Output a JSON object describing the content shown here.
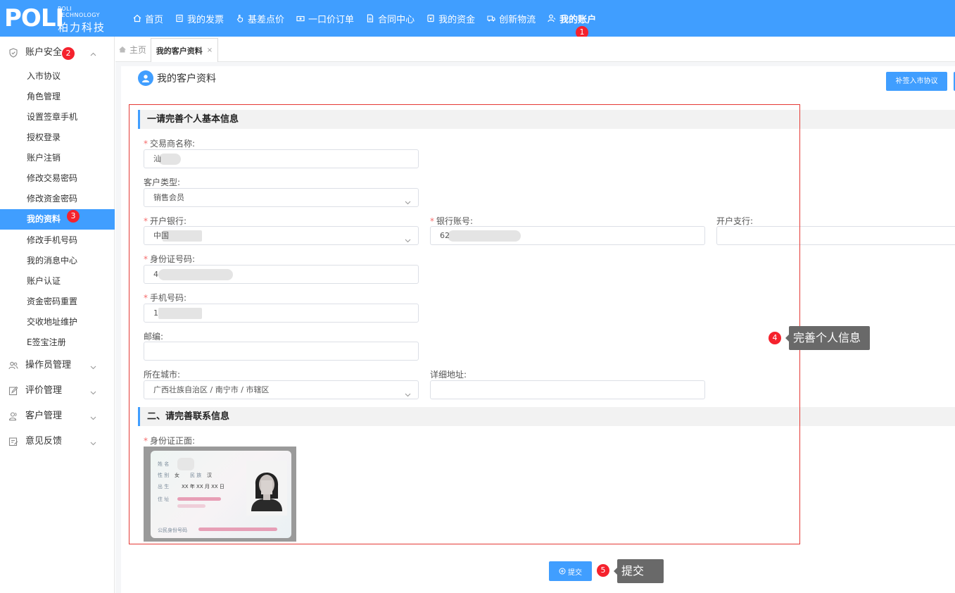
{
  "brand": {
    "logo_text": "POLI",
    "logo_en_line1": "POLI",
    "logo_en_line2": "TECHNOLOGY",
    "logo_cn": "粕力科技"
  },
  "topnav": {
    "items": [
      {
        "label": "首页",
        "icon": "home-icon"
      },
      {
        "label": "我的发票",
        "icon": "invoice-icon"
      },
      {
        "label": "基差点价",
        "icon": "pointer-hand-icon"
      },
      {
        "label": "一口价订单",
        "icon": "order-icon"
      },
      {
        "label": "合同中心",
        "icon": "document-icon"
      },
      {
        "label": "我的资金",
        "icon": "wallet-icon"
      },
      {
        "label": "创新物流",
        "icon": "truck-icon"
      },
      {
        "label": "我的账户",
        "icon": "user-icon",
        "active": true
      }
    ]
  },
  "badges": {
    "b1": "1",
    "b2": "2",
    "b3": "3",
    "b4": "4",
    "b5": "5"
  },
  "sidebar": {
    "group_account": "账户安全",
    "items": [
      "入市协议",
      "角色管理",
      "设置签章手机",
      "授权登录",
      "账户注销",
      "修改交易密码",
      "修改资金密码",
      "我的资料",
      "修改手机号码",
      "我的消息中心",
      "账户认证",
      "资金密码重置",
      "交收地址维护",
      "E签宝注册"
    ],
    "active_item": "我的资料",
    "group_operator": "操作员管理",
    "group_review": "评价管理",
    "group_customer": "客户管理",
    "group_feedback": "意见反馈"
  },
  "tabs": {
    "home": "主页",
    "active": "我的客户资料",
    "close": "×"
  },
  "page": {
    "title": "我的客户资料",
    "sign_button": "补签入市协议"
  },
  "form": {
    "section1_title": "一请完善个人基本信息",
    "trader_name_label": "交易商名称:",
    "trader_name_value": "汕",
    "customer_type_label": "客户类型:",
    "customer_type_value": "销售会员",
    "bank_label": "开户银行:",
    "bank_value": "中国",
    "account_label": "银行账号:",
    "account_value": "62",
    "branch_label": "开户支行:",
    "branch_value": "",
    "id_label": "身份证号码:",
    "id_value": "4",
    "phone_label": "手机号码:",
    "phone_value": "1",
    "zip_label": "邮编:",
    "zip_value": "",
    "city_label": "所在城市:",
    "city_value": "广西壮族自治区 / 南宁市 / 市辖区",
    "address_label": "详细地址:",
    "address_value": "",
    "section2_title": "二、请完善联系信息",
    "id_front_label": "身份证正面:"
  },
  "id_card": {
    "name_label": "姓 名",
    "sex_label": "性 别",
    "sex_value": "女",
    "ethnic_label": "民 族",
    "ethnic_value": "汉",
    "birth_label": "出 生",
    "birth_value": "XX 年 XX 月 XX 日",
    "addr_label": "住 址",
    "idno_label": "公民身份号码"
  },
  "tooltips": {
    "complete_info": "完善个人信息",
    "submit_hint": "提交"
  },
  "submit": {
    "label": "提交"
  },
  "colors": {
    "primary": "#409eff",
    "badge": "#f5222d",
    "frame": "#e53935",
    "tooltip": "#696969"
  }
}
